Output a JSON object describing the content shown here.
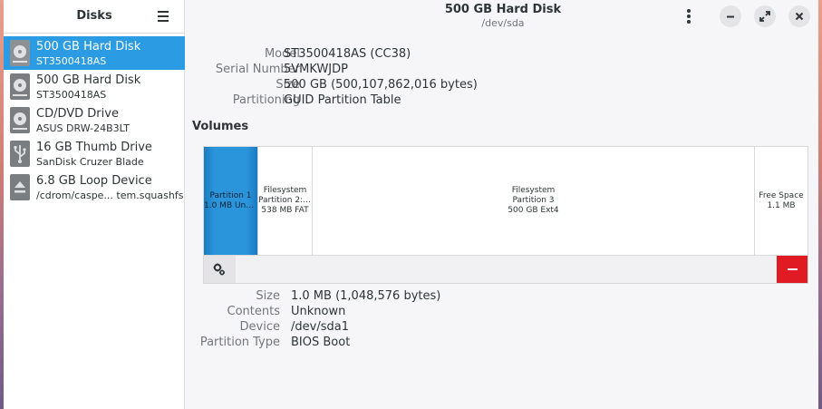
{
  "sidebar": {
    "title": "Disks",
    "devices": [
      {
        "name": "500 GB Hard Disk",
        "sub": "ST3500418AS",
        "icon": "hard-disk-icon",
        "selected": true
      },
      {
        "name": "500 GB Hard Disk",
        "sub": "ST3500418AS",
        "icon": "hard-disk-icon",
        "selected": false
      },
      {
        "name": "CD/DVD Drive",
        "sub": "ASUS    DRW-24B3LT",
        "icon": "optical-drive-icon",
        "selected": false
      },
      {
        "name": "16 GB Thumb Drive",
        "sub": "SanDisk Cruzer Blade",
        "icon": "usb-icon",
        "selected": false
      },
      {
        "name": "6.8 GB Loop Device",
        "sub": "/cdrom/caspe...  tem.squashfs",
        "icon": "eject-icon",
        "selected": false
      }
    ]
  },
  "header": {
    "title": "500 GB Hard Disk",
    "subtitle": "/dev/sda"
  },
  "drive_info": [
    {
      "label": "Model",
      "value": "ST3500418AS (CC38)"
    },
    {
      "label": "Serial Number",
      "value": "5VMKWJDP"
    },
    {
      "label": "Size",
      "value": "500 GB (500,107,862,016 bytes)"
    },
    {
      "label": "Partitioning",
      "value": "GUID Partition Table"
    }
  ],
  "volumes": {
    "heading": "Volumes",
    "items": [
      {
        "lines": [
          "Partition 1",
          "1.0 MB Unk..."
        ],
        "selected": true
      },
      {
        "lines": [
          "Filesystem",
          "Partition 2: ...",
          "538 MB FAT"
        ],
        "selected": false
      },
      {
        "lines": [
          "Filesystem",
          "Partition 3",
          "500 GB Ext4"
        ],
        "selected": false
      },
      {
        "lines": [
          "Free Space",
          "1.1 MB"
        ],
        "selected": false
      }
    ]
  },
  "partition_info": [
    {
      "label": "Size",
      "value": "1.0 MB (1,048,576 bytes)"
    },
    {
      "label": "Contents",
      "value": "Unknown"
    },
    {
      "label": "Device",
      "value": "/dev/sda1"
    },
    {
      "label": "Partition Type",
      "value": "BIOS Boot"
    }
  ],
  "colors": {
    "accent": "#2b9be3",
    "destructive": "#e01b24"
  }
}
